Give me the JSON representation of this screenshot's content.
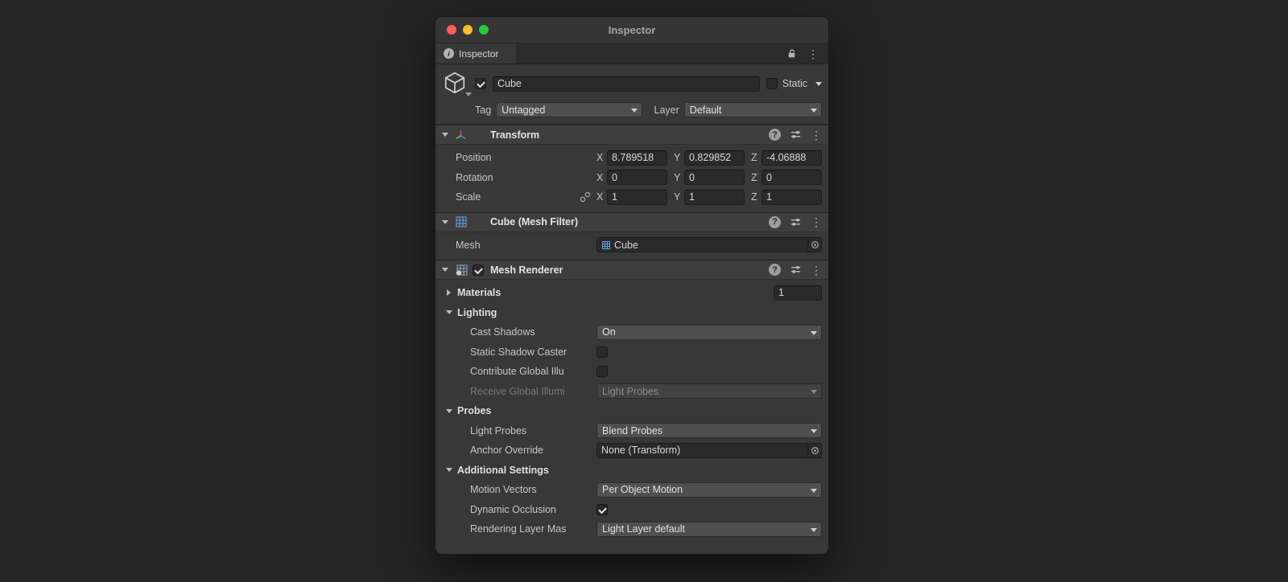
{
  "icons": {
    "kebab": "⋮",
    "help": "?",
    "info": "i"
  },
  "titlebar": {
    "title": "Inspector"
  },
  "tabs": {
    "inspector": "Inspector"
  },
  "gameobject": {
    "name": "Cube",
    "static_label": "Static",
    "tag": {
      "label": "Tag",
      "value": "Untagged"
    },
    "layer": {
      "label": "Layer",
      "value": "Default"
    }
  },
  "transform": {
    "title": "Transform",
    "axis": {
      "x": "X",
      "y": "Y",
      "z": "Z"
    },
    "position": {
      "label": "Position",
      "x": "8.789518",
      "y": "0.829852",
      "z": "-4.06888"
    },
    "rotation": {
      "label": "Rotation",
      "x": "0",
      "y": "0",
      "z": "0"
    },
    "scale": {
      "label": "Scale",
      "x": "1",
      "y": "1",
      "z": "1"
    }
  },
  "mesh_filter": {
    "title": "Cube (Mesh Filter)",
    "mesh": {
      "label": "Mesh",
      "value": "Cube"
    }
  },
  "mesh_renderer": {
    "title": "Mesh Renderer",
    "materials": {
      "label": "Materials",
      "count": "1"
    },
    "lighting": {
      "title": "Lighting",
      "cast_shadows": {
        "label": "Cast Shadows",
        "value": "On"
      },
      "static_shadow_caster": {
        "label": "Static Shadow Caster"
      },
      "contribute_gi": {
        "label": "Contribute Global Illu"
      },
      "receive_gi": {
        "label": "Receive Global Illumi",
        "value": "Light Probes"
      }
    },
    "probes": {
      "title": "Probes",
      "light_probes": {
        "label": "Light Probes",
        "value": "Blend Probes"
      },
      "anchor_override": {
        "label": "Anchor Override",
        "value": "None (Transform)"
      }
    },
    "additional_settings": {
      "title": "Additional Settings",
      "motion_vectors": {
        "label": "Motion Vectors",
        "value": "Per Object Motion"
      },
      "dynamic_occlusion": {
        "label": "Dynamic Occlusion"
      },
      "rendering_layer_mask": {
        "label": "Rendering Layer Mas",
        "value": "Light Layer default"
      }
    }
  }
}
